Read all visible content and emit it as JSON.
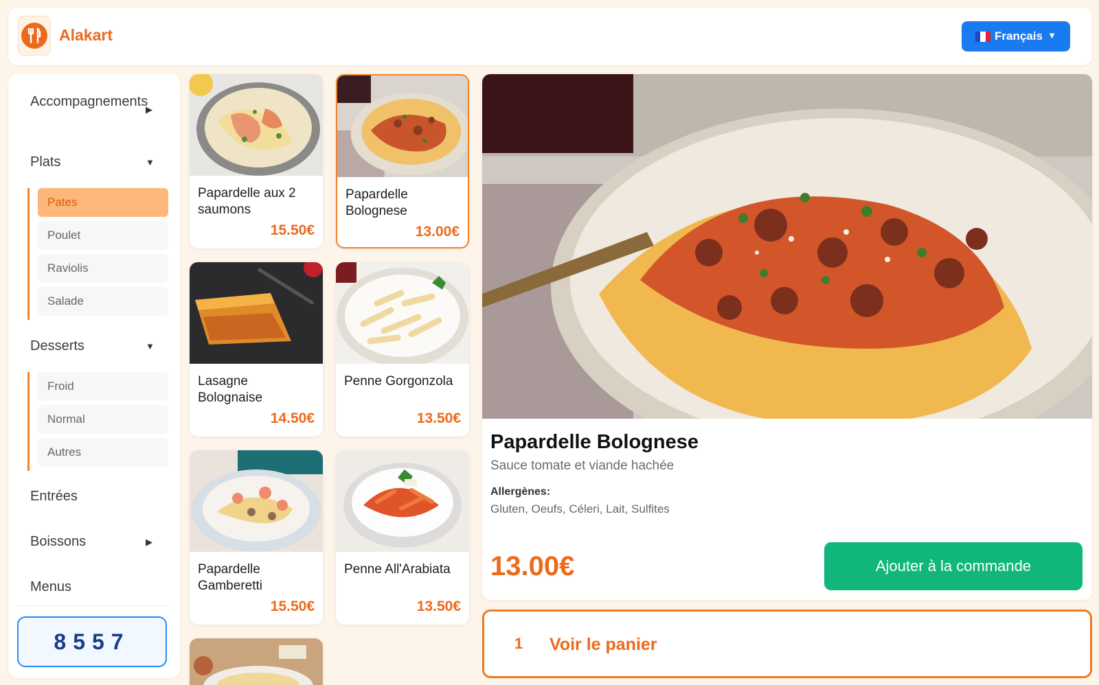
{
  "header": {
    "brand": "Alakart",
    "language": "Français"
  },
  "sidebar": {
    "categories": [
      {
        "label": "Accompagnements",
        "expanded": false
      },
      {
        "label": "Plats",
        "expanded": true,
        "subs": [
          "Pates",
          "Poulet",
          "Raviolis",
          "Salade"
        ],
        "active": "Pates"
      },
      {
        "label": "Desserts",
        "expanded": true,
        "subs": [
          "Froid",
          "Normal",
          "Autres"
        ]
      },
      {
        "label": "Entrées"
      },
      {
        "label": "Boissons",
        "expanded": false
      },
      {
        "label": "Menus"
      }
    ],
    "code": "8557"
  },
  "products": [
    {
      "name": "Papardelle aux 2 saumons",
      "price": "15.50€"
    },
    {
      "name": "Papardelle Bolognese",
      "price": "13.00€",
      "selected": true
    },
    {
      "name": "Lasagne Bolognaise",
      "price": "14.50€"
    },
    {
      "name": "Penne Gorgonzola",
      "price": "13.50€"
    },
    {
      "name": "Papardelle Gamberetti",
      "price": "15.50€"
    },
    {
      "name": "Penne All'Arabiata",
      "price": "13.50€"
    }
  ],
  "detail": {
    "title": "Papardelle Bolognese",
    "description": "Sauce tomate et viande hachée",
    "allergens_label": "Allergènes:",
    "allergens": "Gluten, Oeufs, Céleri, Lait, Sulfites",
    "price": "13.00€",
    "add_button": "Ajouter à la commande"
  },
  "cart": {
    "count": "1",
    "label": "Voir le panier"
  },
  "colors": {
    "accent": "#ec6a1c",
    "language_button": "#1a7af0",
    "add_button": "#11b67a",
    "background": "#fdf4ea"
  },
  "icons": [
    "logo-fork-knife-icon",
    "flag-fr-icon",
    "chevron-down-icon",
    "chevron-right-icon"
  ]
}
